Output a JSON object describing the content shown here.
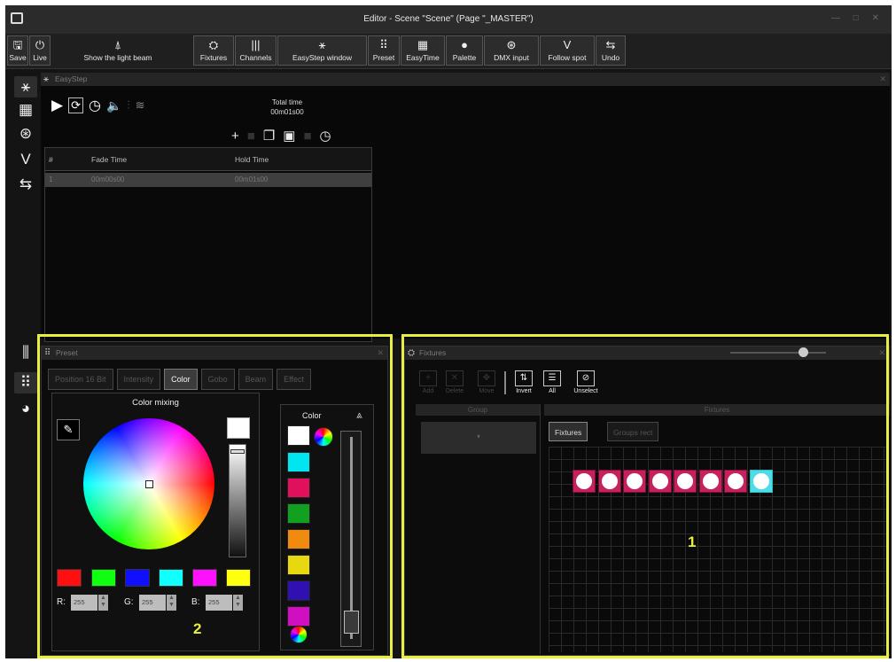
{
  "window": {
    "title": "Editor - Scene \"Scene\" (Page \"_MASTER\")"
  },
  "toolbar": {
    "save": "Save",
    "live": "Live",
    "beam": "Show the light beam",
    "fixtures": "Fixtures",
    "channels": "Channels",
    "easystep": "EasyStep window",
    "preset": "Preset",
    "easytime": "EasyTime",
    "palette": "Palette",
    "dmx": "DMX input",
    "follow": "Follow spot",
    "undo": "Undo"
  },
  "easystep": {
    "title": "EasyStep",
    "total_time_label": "Total time",
    "total_time": "00m01s00",
    "columns": [
      "#",
      "Fade Time",
      "Hold Time"
    ],
    "rows": [
      {
        "num": "1",
        "fade": "00m00s00",
        "hold": "00m01s00"
      }
    ]
  },
  "preset": {
    "title": "Preset",
    "tabs": [
      "Position 16 Bit",
      "Intensity",
      "Color",
      "Gobo",
      "Beam",
      "Effect"
    ],
    "active_tab": "Color",
    "color_mixing": "Color mixing",
    "color_panel": "Color",
    "rgb": {
      "r_label": "R:",
      "r": "255",
      "g_label": "G:",
      "g": "255",
      "b_label": "B:",
      "b": "255"
    },
    "quick_swatches": [
      "#ff1010",
      "#10ff10",
      "#1010ff",
      "#10ffff",
      "#ff10ff",
      "#ffff10"
    ],
    "color_list": [
      "#ffffff",
      "#00e5f0",
      "#e0105c",
      "#12a020",
      "#f08a10",
      "#e8d810",
      "#3010b0",
      "#d010c0"
    ],
    "callout": "2"
  },
  "fixtures": {
    "title": "Fixtures",
    "tools": [
      "Add",
      "Delete",
      "Move",
      "Invert",
      "All",
      "Unselect"
    ],
    "group_header": "Group",
    "group_item": "*",
    "fixtures_header": "Fixtures",
    "tabs": [
      "Fixtures",
      "Groups rect"
    ],
    "fixture_count": 8,
    "selected_index": 7,
    "callout": "1"
  }
}
